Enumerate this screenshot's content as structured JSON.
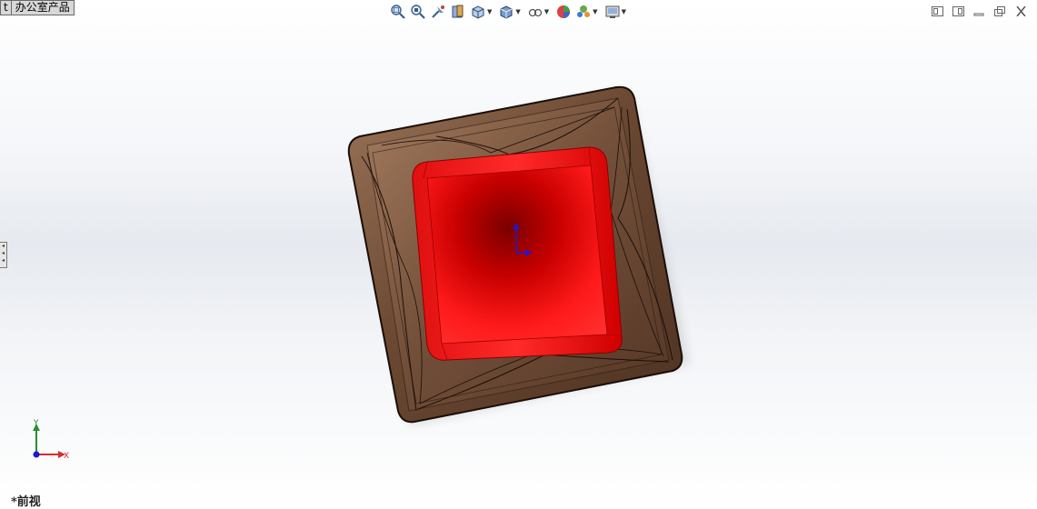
{
  "tabs": [
    {
      "label": "t"
    },
    {
      "label": "办公室产品"
    }
  ],
  "toolbar": {
    "items": [
      {
        "name": "zoom-to-fit-icon"
      },
      {
        "name": "zoom-to-area-icon"
      },
      {
        "name": "previous-view-icon"
      },
      {
        "name": "section-view-icon"
      },
      {
        "name": "view-orientation-icon"
      },
      {
        "name": "display-style-icon"
      },
      {
        "name": "hide-show-items-icon"
      },
      {
        "name": "edit-appearance-icon"
      },
      {
        "name": "apply-scene-icon"
      },
      {
        "name": "view-settings-icon"
      }
    ]
  },
  "window_controls": [
    "tile-left-icon",
    "tile-right-icon",
    "minimize-icon",
    "restore-icon",
    "close-icon"
  ],
  "triad": {
    "y_label": "Y",
    "x_label": "X"
  },
  "view": {
    "name": "*前视"
  },
  "colors": {
    "outer_shell": "#6b4a34",
    "inner_cup": "#ff1a1a",
    "axis_x": "#d03030",
    "axis_y": "#2e8b2e",
    "axis_z": "#1a1ad0"
  }
}
